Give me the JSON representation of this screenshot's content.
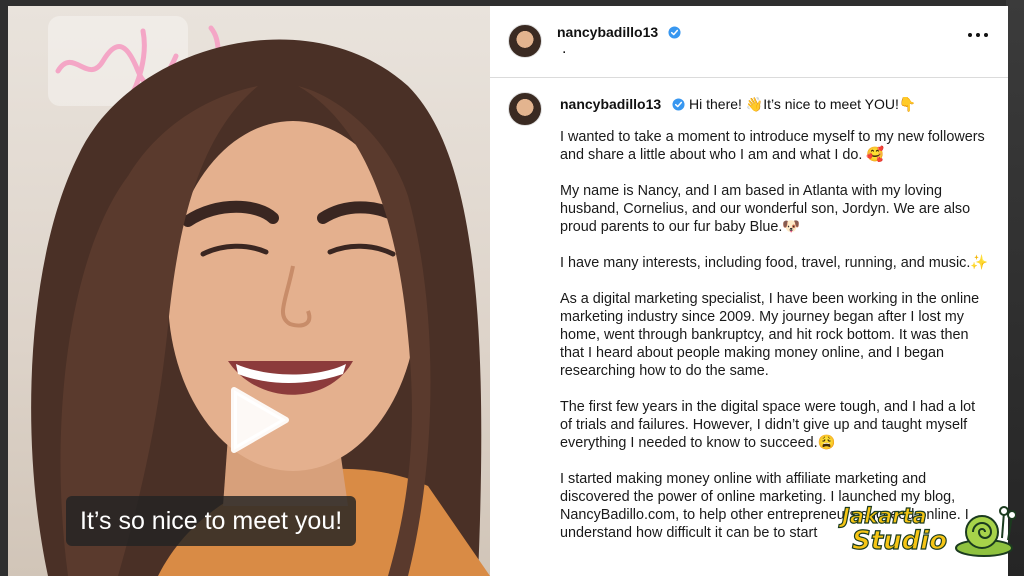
{
  "video": {
    "caption": "It’s so nice to meet you!",
    "play_icon": "play-icon"
  },
  "post": {
    "header": {
      "username": "nancybadillo13",
      "location_dot": ".",
      "more_icon": "more-options-icon"
    },
    "caption": {
      "username": "nancybadillo13",
      "greeting": "Hi there! 👋It’s nice to meet YOU!👇",
      "paragraphs": [
        "I wanted to take a moment to introduce myself to my new followers and share a little about who I am and what I do. 🥰",
        "My name is Nancy, and I am based in Atlanta with my loving husband, Cornelius, and our wonderful son, Jordyn. We are also proud parents to our fur baby Blue.🐶",
        "I have many interests, including food, travel, running, and music.✨",
        "As a digital marketing specialist, I have been working in the online marketing industry since 2009. My journey began after I lost my home, went through bankruptcy, and hit rock bottom. It was then that I heard about people making money online, and I began researching how to do the same.",
        "The first few years in the digital space were tough, and I had a lot of trials and failures. However, I didn’t give up and taught myself everything I needed to know to succeed.😩",
        "I started making money online with affiliate marketing and discovered the power of online marketing. I launched my blog, NancyBadillo.com, to help other entrepreneurs succeed online. I understand how difficult it can be to start"
      ]
    },
    "verified_color": "#3897f0"
  },
  "watermark": {
    "line1": "Jakarta",
    "line2": "Studio"
  }
}
